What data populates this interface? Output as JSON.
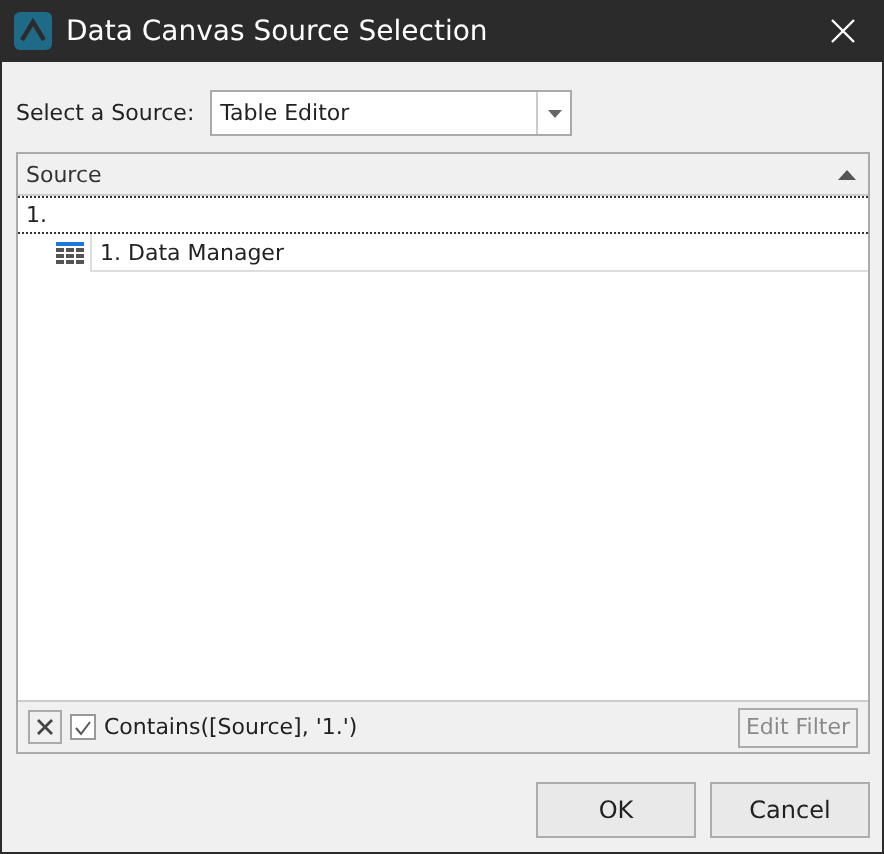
{
  "window": {
    "title": "Data Canvas Source Selection"
  },
  "source_select": {
    "label": "Select a Source:",
    "value": "Table Editor"
  },
  "grid": {
    "column": {
      "label": "Source",
      "sorted_ascending": true
    },
    "filter_row": {
      "value": "1."
    },
    "rows": [
      {
        "label": "1. Data Manager",
        "selected": false
      }
    ]
  },
  "filter_panel": {
    "enabled": true,
    "expression": "Contains([Source], '1.')",
    "edit_button": {
      "label": "Edit Filter",
      "disabled": true
    }
  },
  "buttons": [
    "OK",
    "Cancel"
  ]
}
